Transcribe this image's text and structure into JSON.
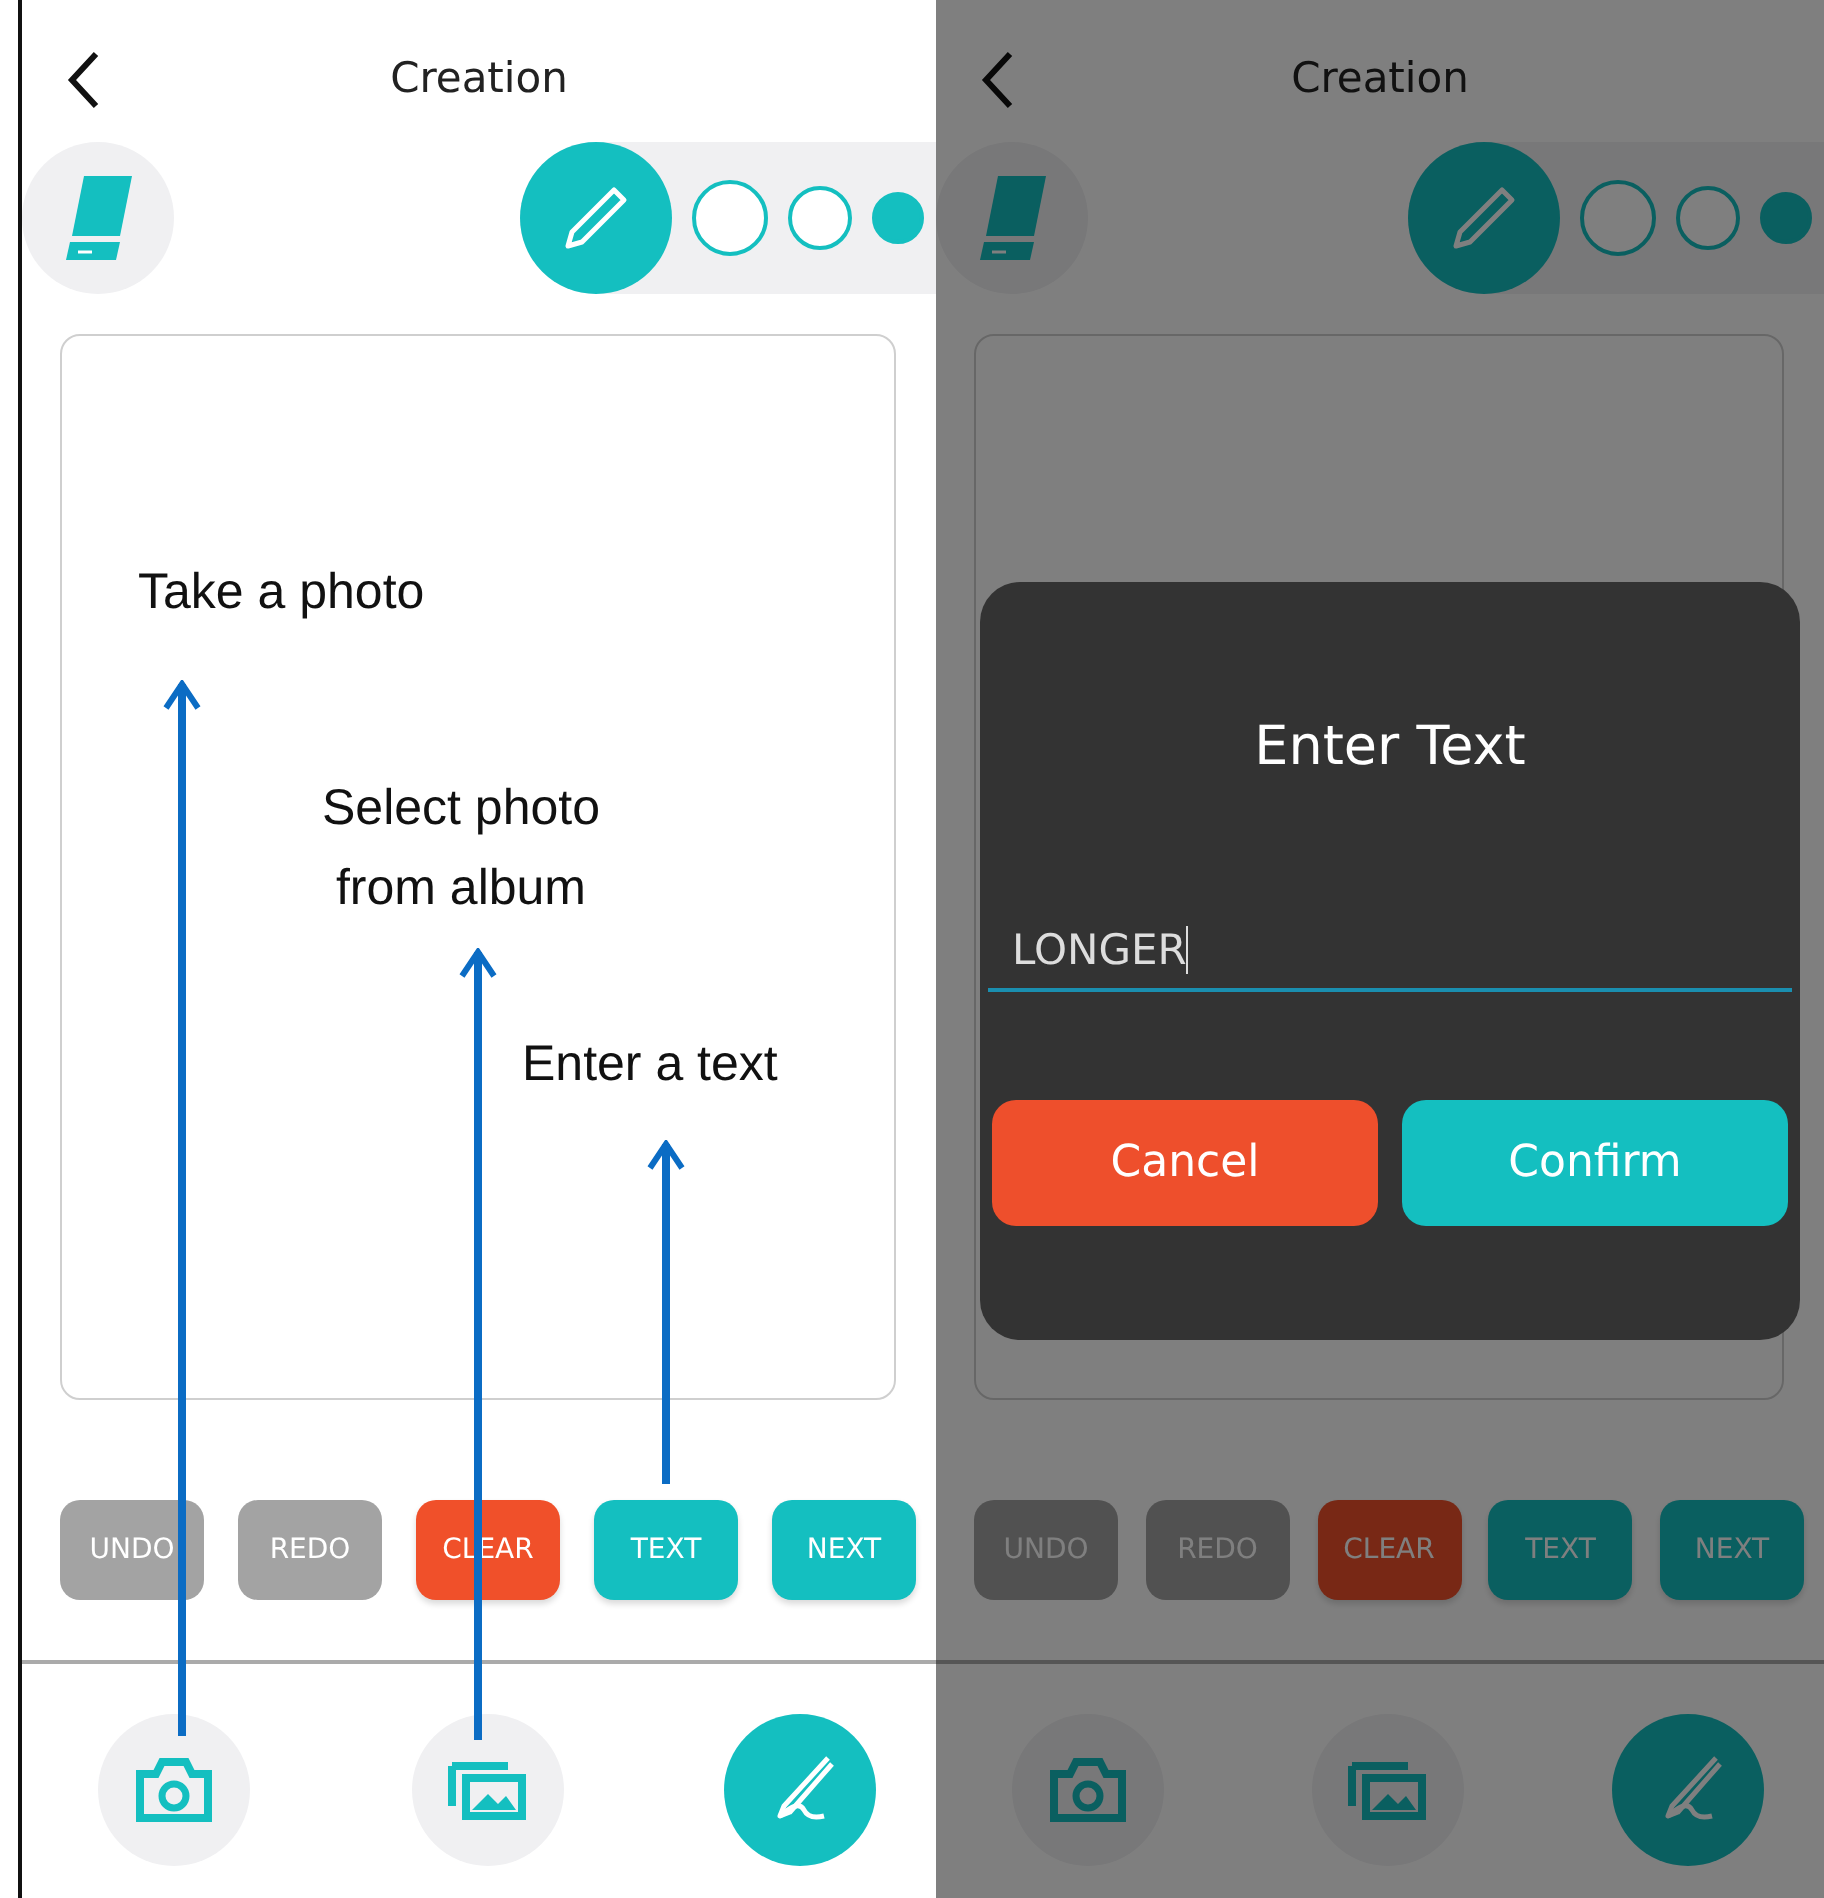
{
  "screens": [
    {
      "title": "Creation",
      "dimmed": false,
      "brush_sizes": [
        {
          "selected": false
        },
        {
          "selected": false
        },
        {
          "selected": true
        }
      ],
      "actions": [
        {
          "label": "UNDO",
          "kind": "neutral",
          "disabled": true
        },
        {
          "label": "REDO",
          "kind": "neutral",
          "disabled": true
        },
        {
          "label": "CLEAR",
          "kind": "danger",
          "disabled": false
        },
        {
          "label": "TEXT",
          "kind": "primary",
          "disabled": false
        },
        {
          "label": "NEXT",
          "kind": "primary",
          "disabled": false
        }
      ],
      "bottom_nav": [
        {
          "kind": "camera",
          "selected": false
        },
        {
          "kind": "gallery",
          "selected": false
        },
        {
          "kind": "draw",
          "selected": true
        }
      ],
      "annotations": [
        "Take a photo",
        "Select photo\nfrom album",
        "Enter a text"
      ]
    },
    {
      "title": "Creation",
      "dimmed": true,
      "brush_sizes": [
        {
          "selected": false
        },
        {
          "selected": false
        },
        {
          "selected": true
        }
      ],
      "actions": [
        {
          "label": "UNDO",
          "kind": "neutral",
          "disabled": true
        },
        {
          "label": "REDO",
          "kind": "neutral",
          "disabled": true
        },
        {
          "label": "CLEAR",
          "kind": "danger",
          "disabled": false
        },
        {
          "label": "TEXT",
          "kind": "primary",
          "disabled": false
        },
        {
          "label": "NEXT",
          "kind": "primary",
          "disabled": false
        }
      ],
      "bottom_nav": [
        {
          "kind": "camera",
          "selected": false
        },
        {
          "kind": "gallery",
          "selected": false
        },
        {
          "kind": "draw",
          "selected": true
        }
      ],
      "dialog": {
        "title": "Enter Text",
        "value": "LONGER",
        "cancel": "Cancel",
        "confirm": "Confirm"
      }
    }
  ]
}
